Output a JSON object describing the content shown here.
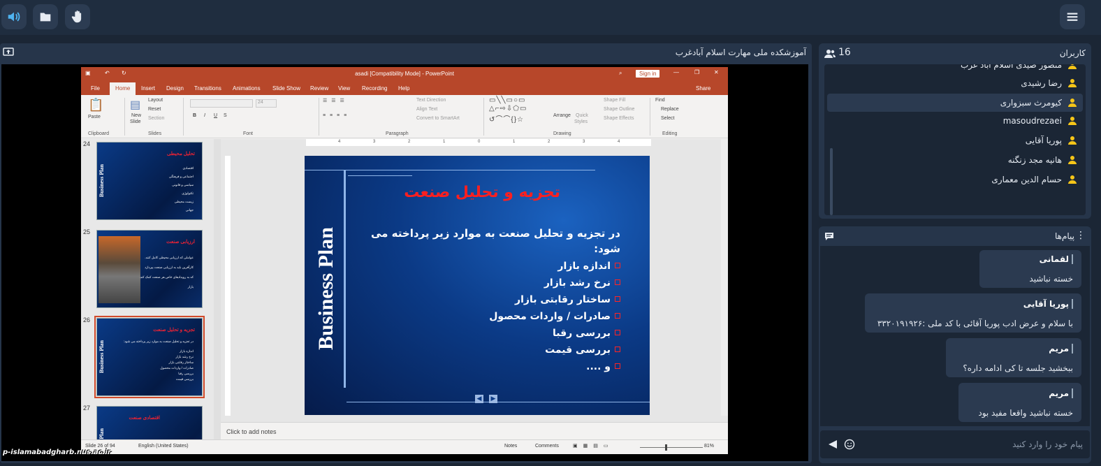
{
  "window": {
    "presentation_title": "آموزشکده ملی مهارت اسلام آبادغرب",
    "site_label": "p-islamabadgharb.nus.ac.ir"
  },
  "topbar": {
    "left_buttons": [
      "speaker-icon",
      "folder-icon",
      "hand-icon"
    ],
    "right_button": "menu-icon"
  },
  "ppt": {
    "title": "asadi [Compatibility Mode] - PowerPoint",
    "sign_in": "Sign in",
    "share": "Share",
    "tabs": [
      "File",
      "Home",
      "Insert",
      "Design",
      "Transitions",
      "Animations",
      "Slide Show",
      "Review",
      "View",
      "Recording",
      "Help"
    ],
    "active_tab": "Home",
    "ribbon": {
      "paste": "Paste",
      "clipboard": "Clipboard",
      "new_slide": "New",
      "new_slide_2": "Slide",
      "layout": "Layout",
      "reset": "Reset",
      "section": "Section",
      "slides": "Slides",
      "font_size": "24",
      "font": "Font",
      "text_direction": "Text Direction",
      "align_text": "Align Text",
      "convert_smartart": "Convert to SmartArt",
      "paragraph": "Paragraph",
      "arrange": "Arrange",
      "quick_styles": "Quick",
      "quick_styles_2": "Styles",
      "shape_fill": "Shape Fill",
      "shape_outline": "Shape Outline",
      "shape_effects": "Shape Effects",
      "drawing": "Drawing",
      "find": "Find",
      "replace": "Replace",
      "select": "Select",
      "editing": "Editing"
    },
    "thumbnails": [
      {
        "num": "24",
        "title": "تحلیل محیطی",
        "lines": [
          "اقتصادی",
          "اجتماعی و فرهنگی",
          "سیاسی و قانونی",
          "تکنولوژی",
          "زیست محیطی",
          "جهانی"
        ]
      },
      {
        "num": "25",
        "title": "ارزیابی صنعت",
        "lines": [
          "عواملی که ارزیابی محیطی کامل کنند.",
          "کارآفرین باید به ارزیابی صنعت بپردازد",
          "که به رویدادهای خاص هر صنعت کمک کند.",
          "بازار"
        ]
      },
      {
        "num": "26",
        "title": "تجزیه و تحلیل صنعت",
        "lines": [
          "در تجزیه و تحلیل صنعت به موارد زیر پرداخته می شود:",
          "اندازه بازار",
          "نرخ رشد بازار",
          "ساختار رقابتی بازار",
          "صادرات / واردات محصول",
          "بررسی رقبا",
          "بررسی قیمت"
        ]
      },
      {
        "num": "27",
        "title": "اقتصادی صنعت",
        "lines": []
      }
    ],
    "slide": {
      "side_text": "Business Plan",
      "title": "تجزیه و تحلیل صنعت",
      "lead": "در تجزیه و تحلیل صنعت به موارد زیر پرداخته می شود:",
      "bullets": [
        "اندازه بازار",
        "نرخ رشد بازار",
        "ساختار رقابتی بازار",
        "صادرات / واردات محصول",
        "بررسی رقبا",
        "بررسی قیمت",
        "و ...."
      ]
    },
    "notes_placeholder": "Click to add notes",
    "status": {
      "slide": "Slide 26 of 94",
      "language": "English (United States)",
      "notes": "Notes",
      "comments": "Comments",
      "zoom": "81%"
    },
    "ruler_ticks": [
      "4",
      "3",
      "2",
      "1",
      "0",
      "1",
      "2",
      "3",
      "4"
    ]
  },
  "users": {
    "title": "کاربران",
    "count": "16",
    "list": [
      {
        "name": "منصور صیدی اسلام آباد غرب",
        "highlight": false
      },
      {
        "name": "رضا رشیدی",
        "highlight": false
      },
      {
        "name": "کیومرث سبزواری",
        "highlight": true
      },
      {
        "name": "masoudrezaei",
        "highlight": false
      },
      {
        "name": "پوریا آقایی",
        "highlight": false
      },
      {
        "name": "هانیه مجد زنگنه",
        "highlight": false
      },
      {
        "name": "حسام الدین معماری",
        "highlight": false
      }
    ]
  },
  "chat": {
    "title": "پیام‌ها",
    "messages": [
      {
        "sender": "لقمانی",
        "text": "خسته نباشید"
      },
      {
        "sender": "پوریا آقایی",
        "text": "با سلام و عرض ادب پوریا آقائی با کد ملی :۳۳۲۰۱۹۱۹۲۶"
      },
      {
        "sender": "مریم",
        "text": "ببخشید جلسه تا کی ادامه داره؟"
      },
      {
        "sender": "مریم",
        "text": "خسته نباشید واقعا مفید بود"
      }
    ],
    "input_placeholder": "پیام خود را وارد کنید"
  },
  "colors": {
    "app_bg": "#1b2635",
    "panel_bg": "#26354a",
    "ppt_accent": "#b7472a",
    "slide_title": "#ff1f1f",
    "user_icon": "#f5c518"
  }
}
